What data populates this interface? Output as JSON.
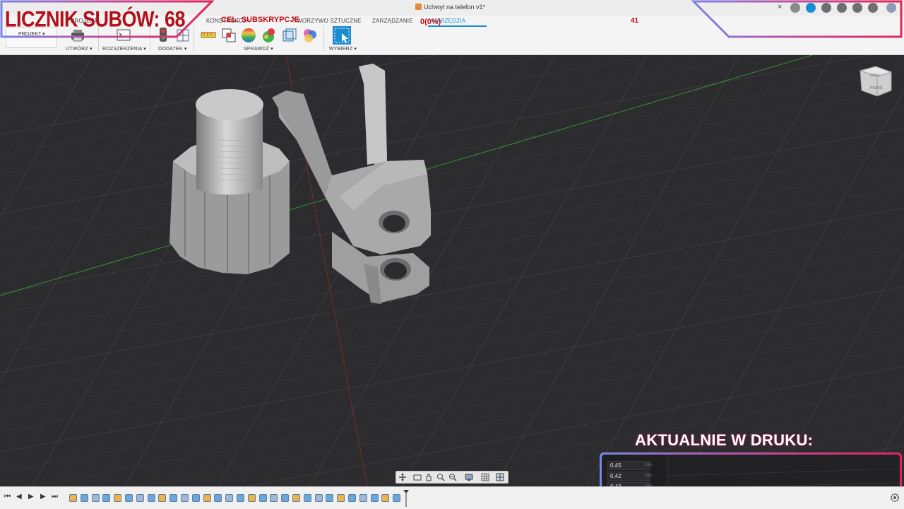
{
  "window": {
    "doc_title": "Uchwyt na telefon v1*",
    "close_symbol": "×"
  },
  "tabs": [
    {
      "label": "PROJEKT"
    },
    {
      "label": "KONSTRUKCJA"
    },
    {
      "label": "TWORZYWO SZTUCZNE"
    },
    {
      "label": "ZARZĄDZANIE"
    },
    {
      "label": "NARZĘDZIA",
      "active": true
    }
  ],
  "workspace": {
    "label": "PROJEKT ▾"
  },
  "toolbar": {
    "groups": [
      {
        "label": "UTWÓRZ ▾"
      },
      {
        "label": "ROZSZERZENIA ▾"
      },
      {
        "label": "DODATEK ▾"
      },
      {
        "label": "SPRAWDŹ ▾"
      },
      {
        "label": "WYBIERZ ▾"
      }
    ]
  },
  "overlay": {
    "sub_counter": "LICZNIK SUBÓW: 68",
    "goal_label": "CEL: SUBSKRYPCJE",
    "goal_progress": "0(0%)",
    "goal_count": "41",
    "printing_label": "AKTUALNIE W DRUKU:"
  },
  "print_params": [
    {
      "value": "0,45",
      "unit": "mm"
    },
    {
      "value": "0,42",
      "unit": "mm"
    },
    {
      "value": "0,42",
      "unit": "mm"
    }
  ],
  "viewcube": {
    "face_top": "GÓRA",
    "face_front": "PRZÓD"
  },
  "timeline": {
    "buttons": [
      "⏮",
      "◀",
      "▶",
      "▶",
      "⏭"
    ],
    "feature_count": 30
  },
  "colors": {
    "accent": "#1b8ccf",
    "overlay_red": "#c00e18",
    "frame_gradient": [
      "#7b86e6",
      "#c24c9a",
      "#e2245a"
    ],
    "viewport_bg": "#2c2c2e",
    "model": "#b9b9b9"
  }
}
